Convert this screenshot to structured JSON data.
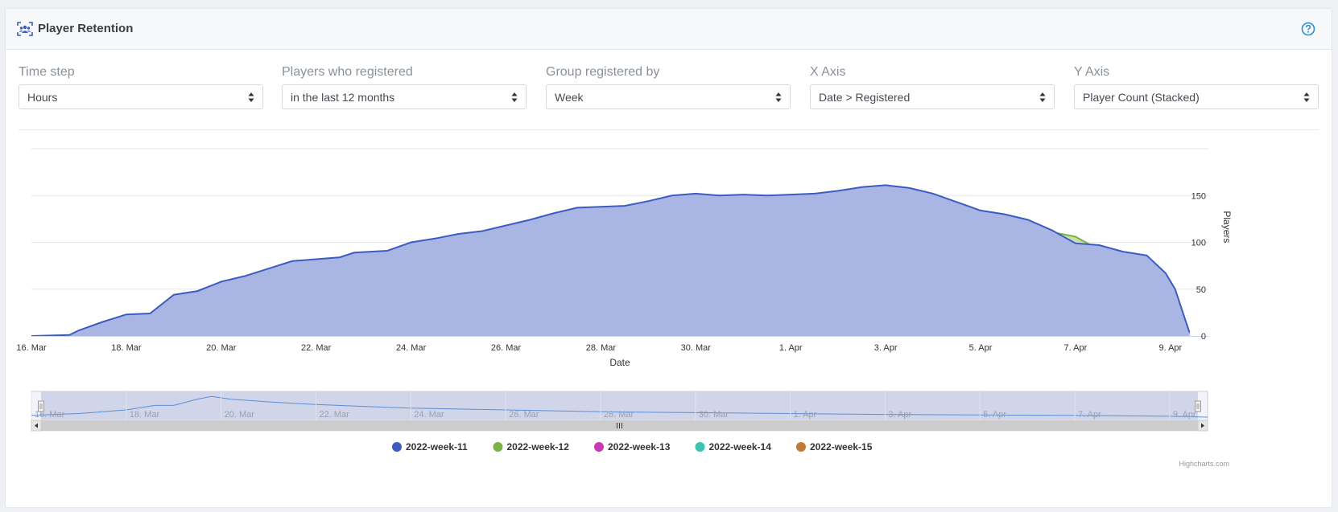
{
  "panel": {
    "title": "Player Retention",
    "help_icon": "question-circle-icon",
    "title_icon": "users-icon"
  },
  "controls": [
    {
      "label": "Time step",
      "value": "Hours"
    },
    {
      "label": "Players who registered",
      "value": "in the last 12 months"
    },
    {
      "label": "Group registered by",
      "value": "Week"
    },
    {
      "label": "X Axis",
      "value": "Date > Registered"
    },
    {
      "label": "Y Axis",
      "value": "Player Count (Stacked)"
    }
  ],
  "chart_data": {
    "type": "area",
    "stacked": true,
    "xlabel": "Date",
    "ylabel": "Players",
    "ylim": [
      0,
      200
    ],
    "yticks": [
      0,
      50,
      100,
      150
    ],
    "xlim": [
      16,
      40
    ],
    "xticks": [
      {
        "x": 16,
        "label": "16. Mar"
      },
      {
        "x": 18,
        "label": "18. Mar"
      },
      {
        "x": 20,
        "label": "20. Mar"
      },
      {
        "x": 22,
        "label": "22. Mar"
      },
      {
        "x": 24,
        "label": "24. Mar"
      },
      {
        "x": 26,
        "label": "26. Mar"
      },
      {
        "x": 28,
        "label": "28. Mar"
      },
      {
        "x": 30,
        "label": "30. Mar"
      },
      {
        "x": 32,
        "label": "1. Apr"
      },
      {
        "x": 34,
        "label": "3. Apr"
      },
      {
        "x": 36,
        "label": "5. Apr"
      },
      {
        "x": 38,
        "label": "7. Apr"
      },
      {
        "x": 40,
        "label": "9. Apr"
      }
    ],
    "navigator_ticks": [
      "16. Mar",
      "18. Mar",
      "20. Mar",
      "22. Mar",
      "24. Mar",
      "26. Mar",
      "28. Mar",
      "30. Mar",
      "1. Apr",
      "3. Apr",
      "5. Apr",
      "7. Apr",
      "9. Apr"
    ],
    "x_unit": "day offset (16 = 16. Mar, 32 = 1. Apr)",
    "series": [
      {
        "name": "2022-week-15",
        "color": "#c07a35",
        "fill": "#c07a35",
        "points": [
          [
            16,
            0
          ],
          [
            39.3,
            0
          ],
          [
            39.5,
            1
          ],
          [
            40.2,
            1
          ],
          [
            40.4,
            0
          ]
        ]
      },
      {
        "name": "2022-week-14",
        "color": "#3cc4b0",
        "fill": "#b1e6df",
        "points": [
          [
            16,
            0
          ],
          [
            33.3,
            0
          ],
          [
            33.5,
            8
          ],
          [
            33.7,
            13
          ],
          [
            34.0,
            15
          ],
          [
            34.5,
            21
          ],
          [
            35.0,
            23
          ],
          [
            35.5,
            24
          ],
          [
            36.0,
            26
          ],
          [
            36.5,
            28
          ],
          [
            37.0,
            31
          ],
          [
            37.5,
            32
          ],
          [
            38.0,
            32
          ],
          [
            38.5,
            35
          ],
          [
            39.0,
            36
          ],
          [
            39.5,
            35
          ],
          [
            39.9,
            25
          ],
          [
            40.1,
            14
          ],
          [
            40.4,
            0
          ]
        ]
      },
      {
        "name": "2022-week-13",
        "color": "#c939b5",
        "fill": "#e4addd",
        "points": [
          [
            16,
            0
          ],
          [
            25.2,
            0
          ],
          [
            26.4,
            1
          ],
          [
            26.7,
            14
          ],
          [
            27.0,
            25
          ],
          [
            27.5,
            33
          ],
          [
            27.8,
            49
          ],
          [
            28.5,
            51
          ],
          [
            28.7,
            58
          ],
          [
            29.0,
            70
          ],
          [
            29.5,
            72
          ],
          [
            30.0,
            77
          ],
          [
            31.0,
            78
          ],
          [
            31.5,
            82
          ],
          [
            32.0,
            84
          ],
          [
            32.5,
            92
          ],
          [
            33.0,
            103
          ],
          [
            33.5,
            107
          ],
          [
            34.0,
            110
          ],
          [
            34.5,
            107
          ],
          [
            35.0,
            103
          ],
          [
            35.5,
            101
          ],
          [
            36.0,
            96
          ],
          [
            37.0,
            92
          ],
          [
            37.5,
            84
          ],
          [
            38.0,
            80
          ],
          [
            38.5,
            78
          ],
          [
            39.0,
            73
          ],
          [
            39.5,
            72
          ],
          [
            39.9,
            58
          ],
          [
            40.1,
            45
          ],
          [
            40.4,
            2
          ]
        ]
      },
      {
        "name": "2022-week-12",
        "color": "#7ab342",
        "fill": "#ccdfab",
        "points": [
          [
            16,
            0
          ],
          [
            18.4,
            0
          ],
          [
            19.0,
            1
          ],
          [
            19.5,
            9
          ],
          [
            20.0,
            19
          ],
          [
            20.5,
            32
          ],
          [
            21.0,
            43
          ],
          [
            21.5,
            52
          ],
          [
            22.0,
            53
          ],
          [
            22.5,
            55
          ],
          [
            22.8,
            64
          ],
          [
            23.5,
            66
          ],
          [
            24.0,
            72
          ],
          [
            24.5,
            76
          ],
          [
            25.0,
            86
          ],
          [
            25.5,
            91
          ],
          [
            26.0,
            92
          ],
          [
            26.5,
            98
          ],
          [
            27.0,
            109
          ],
          [
            27.5,
            116
          ],
          [
            28.0,
            118
          ],
          [
            28.5,
            119
          ],
          [
            29.0,
            124
          ],
          [
            29.5,
            133
          ],
          [
            30.0,
            137
          ],
          [
            30.5,
            136
          ],
          [
            31.0,
            137
          ],
          [
            31.5,
            138
          ],
          [
            32.0,
            139
          ],
          [
            32.5,
            141
          ],
          [
            33.0,
            143
          ],
          [
            33.5,
            146
          ],
          [
            34.0,
            149
          ],
          [
            34.5,
            147
          ],
          [
            35.0,
            142
          ],
          [
            35.5,
            133
          ],
          [
            36.0,
            128
          ],
          [
            36.5,
            122
          ],
          [
            37.0,
            118
          ],
          [
            37.5,
            111
          ],
          [
            38.0,
            106
          ],
          [
            38.5,
            92
          ],
          [
            39.0,
            88
          ],
          [
            39.5,
            77
          ],
          [
            39.9,
            64
          ],
          [
            40.1,
            47
          ],
          [
            40.4,
            3
          ]
        ]
      },
      {
        "name": "2022-week-11",
        "color": "#3d5cc0",
        "fill": "#a9b6e3",
        "points": [
          [
            16,
            0
          ],
          [
            16.8,
            1
          ],
          [
            17.0,
            6
          ],
          [
            17.5,
            15
          ],
          [
            18.0,
            23
          ],
          [
            18.5,
            24
          ],
          [
            19.0,
            44
          ],
          [
            19.5,
            48
          ],
          [
            20.0,
            58
          ],
          [
            20.5,
            64
          ],
          [
            21.0,
            72
          ],
          [
            21.5,
            80
          ],
          [
            22.0,
            82
          ],
          [
            22.5,
            84
          ],
          [
            22.8,
            89
          ],
          [
            23.5,
            91
          ],
          [
            24.0,
            100
          ],
          [
            24.5,
            104
          ],
          [
            25.0,
            109
          ],
          [
            25.5,
            112
          ],
          [
            26.0,
            118
          ],
          [
            26.5,
            124
          ],
          [
            27.0,
            131
          ],
          [
            27.5,
            137
          ],
          [
            28.0,
            138
          ],
          [
            28.5,
            139
          ],
          [
            29.0,
            144
          ],
          [
            29.5,
            150
          ],
          [
            30.0,
            152
          ],
          [
            30.5,
            150
          ],
          [
            31.0,
            151
          ],
          [
            31.5,
            150
          ],
          [
            32.0,
            151
          ],
          [
            32.5,
            152
          ],
          [
            33.0,
            155
          ],
          [
            33.5,
            159
          ],
          [
            34.0,
            161
          ],
          [
            34.5,
            158
          ],
          [
            35.0,
            152
          ],
          [
            35.5,
            143
          ],
          [
            36.0,
            134
          ],
          [
            36.5,
            130
          ],
          [
            37.0,
            124
          ],
          [
            37.5,
            113
          ],
          [
            38.0,
            99
          ],
          [
            38.5,
            97
          ],
          [
            39.0,
            90
          ],
          [
            39.5,
            86
          ],
          [
            39.9,
            67
          ],
          [
            40.1,
            50
          ],
          [
            40.4,
            4
          ]
        ]
      }
    ],
    "legend": {
      "placement": "bottom-center",
      "items": [
        "2022-week-11",
        "2022-week-12",
        "2022-week-13",
        "2022-week-14",
        "2022-week-15"
      ]
    },
    "credits": "Highcharts.com"
  }
}
